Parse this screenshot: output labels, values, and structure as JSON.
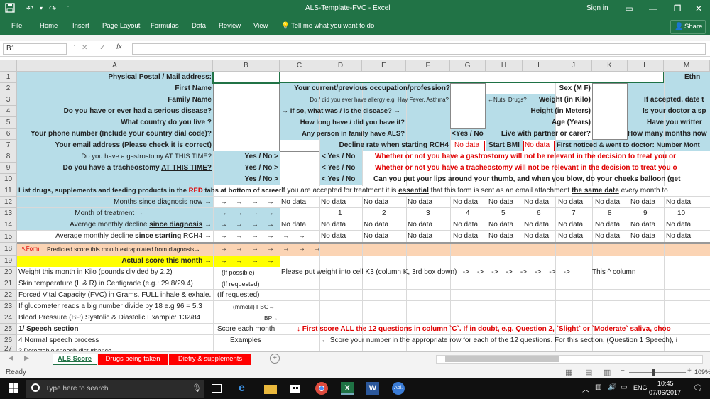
{
  "app": {
    "doc_title": "ALS-Template-FVC - Excel",
    "signin": "Sign in",
    "share": "Share",
    "tell_me": "Tell me what you want to do"
  },
  "ribbon_tabs": [
    "File",
    "Home",
    "Insert",
    "Page Layout",
    "Formulas",
    "Data",
    "Review",
    "View"
  ],
  "formula": {
    "name_box": "B1",
    "fx": "fx",
    "value": ""
  },
  "columns": [
    "A",
    "B",
    "C",
    "D",
    "E",
    "F",
    "G",
    "H",
    "I",
    "J",
    "K",
    "L",
    "M"
  ],
  "rows": [
    "1",
    "2",
    "3",
    "4",
    "5",
    "6",
    "7",
    "8",
    "9",
    "10",
    "11",
    "12",
    "13",
    "14",
    "15",
    "18",
    "19",
    "20",
    "21",
    "22",
    "23",
    "24",
    "25",
    "26",
    "27"
  ],
  "cells": {
    "a1": "Physical Postal / Mail address:",
    "m1": "Ethn",
    "a2": "First Name",
    "d2": "Your current/previous occupation/profession?",
    "j2": "Sex (M F)",
    "a3": "Family Name",
    "d3": "Do / did you ever have allergy e.g. Hay Fever, Asthma?",
    "h3": "←Nuts, Drugs?",
    "j3": "Weight (in Kilo)",
    "l3": "If accepted, date t",
    "a4": "Do you have or ever had a serious disease?",
    "d4": "→ If so, what was / is the disease? →",
    "j4": "Height (in Meters)",
    "l4": "Is your doctor a sp",
    "a5": "What country do you live ?",
    "d5": "How long have / did you have it?",
    "j5": "Age (Years)",
    "l5": "Have you writter",
    "a6": "Your phone number (Include your country dial code)?",
    "d6": "Any person in family have ALS?",
    "g6": "<Yes / No",
    "j6": "Live with partner or carer?",
    "l6": "How many months now",
    "a7": "Your email address (Please check it is correct)",
    "d7": "Decline rate when starting RCH4",
    "g7": "No data",
    "h7": "Start BMI",
    "i7": "No data",
    "j7": "First noticed & went to doctor: Number Mont",
    "a8": "Do you have a gastrostomy AT THIS TIME?",
    "b8": "Yes / No >",
    "d8": "< Yes / No",
    "e8": "Whether or not you have a gastrostomy will not be relevant in the decision to treat you or",
    "a9a": "Do you have a tracheostomy ",
    "a9b": "AT THIS TIME?",
    "b9": "Yes / No >",
    "d9": "< Yes / No",
    "e9": "Whether or not you have a tracheostomy will not be relevant in the decision to treat you o",
    "b10": "Yes / No >",
    "d10": "< Yes / No",
    "e10": "Can you put your lips around your thumb, and when you blow, do your cheeks balloon (get",
    "a11a": "List drugs, supplements and feeding products in the ",
    "a11b": "RED",
    "a11c": " tabs at bottom of screen",
    "d11a": "If you are accepted for treatment it is ",
    "d11b": "essential",
    "d11c": " that this form is sent as an email attachment ",
    "d11d": "the same date",
    "d11e": " every month to",
    "a12": "Months since diagnosis now →",
    "a13": "Month of treatment →",
    "a14a": "Average monthly decline ",
    "a14b": "since diagnosis",
    "a14c": " →",
    "a15a": "Average monthly decline ",
    "a15b": "since starting",
    "a15c": " RCH4 →",
    "a18a": "↖Form",
    "a18b": "Predicted score this month extrapolated from diagnosis→",
    "a19": "Actual score this month →",
    "a20": "Weight this month in Kilo (pounds divided by 2.2)",
    "b20": "(If possible)",
    "d20": "Please put weight into cell K3 (column K, 3rd box down)   ->    ->    ->    ->    ->    ->    ->    ->",
    "k20": "This ^ column",
    "a21": "Skin temperature (L & R) in Centigrade (e.g.: 29.8/29.4)",
    "b21": "(If requested)",
    "a22": "Forced Vital Capacity (FVC) in Grams.  FULL  inhale & exhale.",
    "b22": "(If requested)",
    "a23": "If glucometer reads a big number divide by 18 e.g 96 = 5.3",
    "b23": "(mmol/l)  FBG→",
    "a24": "Blood Pressure (BP) Systolic & Diastolic Example: 132/84",
    "b24": "BP→",
    "a25": "1/ Speech section",
    "b25": "Score each month",
    "d25": "↓ First score ALL the 12 questions in column `C`. If in doubt, e.g. Question 2, `Slight` or `Moderate` saliva, choo",
    "a26": "4 Normal speech process",
    "b26": "Examples",
    "d26": "← Score your number in the appropriate row for each of the 12 questions. For this section, (Question 1 Speech), i",
    "a27": "3 Detectable speech disturbance"
  },
  "months_row": [
    "No data",
    "No data",
    "No data",
    "No data",
    "No data",
    "No data",
    "No data",
    "No data",
    "No data",
    "No data",
    "No data"
  ],
  "treat_row": [
    "",
    "1",
    "2",
    "3",
    "4",
    "5",
    "6",
    "7",
    "8",
    "9",
    "10"
  ],
  "arrow": "→",
  "sheets": {
    "active": "ALS Score",
    "others": [
      "Drugs being taken",
      "Dietry & supplements"
    ]
  },
  "status": {
    "ready": "Ready",
    "zoom": "109%"
  },
  "taskbar": {
    "search": "Type here to search",
    "lang": "ENG",
    "time": "10:45",
    "date": "07/06/2017"
  },
  "colors": {
    "excel_green": "#217346",
    "light_blue": "#b7dde8",
    "yellow": "#ffff00",
    "peach": "#fbd4b4",
    "red": "#e00000"
  }
}
